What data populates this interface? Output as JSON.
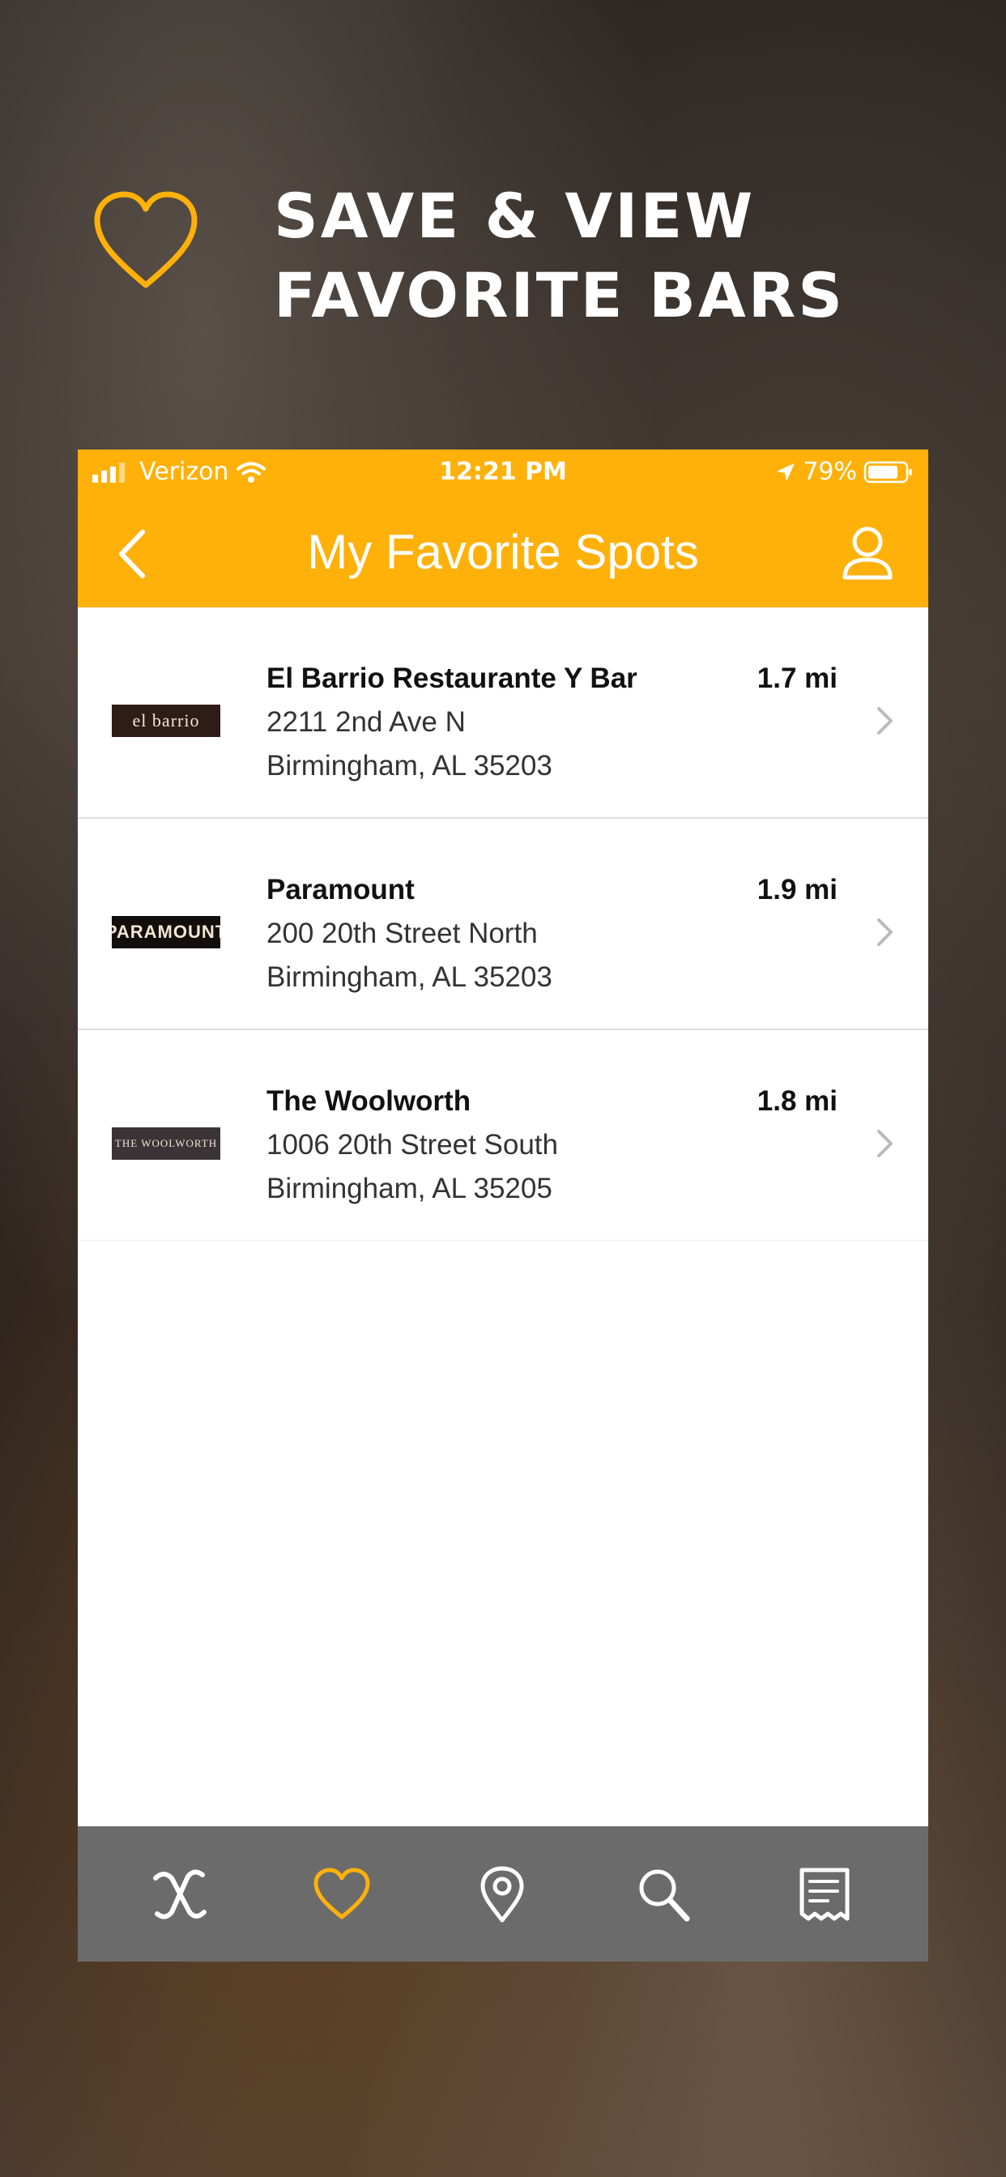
{
  "promo": {
    "title": "SAVE & VIEW\nFAVORITE BARS",
    "icon": "heart-outline-icon",
    "accent": "#FFB10A"
  },
  "status_bar": {
    "carrier": "Verizon",
    "time": "12:21 PM",
    "battery": "79%"
  },
  "nav": {
    "title": "My Favorite Spots",
    "back_icon": "chevron-left-icon",
    "profile_icon": "user-icon",
    "color": "#FFB10A"
  },
  "spots": [
    {
      "logo": "el barrio",
      "name": "El Barrio Restaurante Y Bar",
      "address": "2211 2nd Ave N",
      "city": "Birmingham, AL 35203",
      "distance": "1.7 mi"
    },
    {
      "logo": "PARAMOUNT",
      "name": "Paramount",
      "address": "200 20th Street North",
      "city": "Birmingham, AL 35203",
      "distance": "1.9 mi"
    },
    {
      "logo": "THE WOOLWORTH",
      "name": "The Woolworth",
      "address": "1006 20th Street South",
      "city": "Birmingham, AL 35205",
      "distance": "1.8 mi"
    }
  ],
  "tabs": [
    {
      "icon": "x-logo-icon",
      "active": false
    },
    {
      "icon": "heart-icon",
      "active": true
    },
    {
      "icon": "map-pin-icon",
      "active": false
    },
    {
      "icon": "search-icon",
      "active": false
    },
    {
      "icon": "receipt-icon",
      "active": false
    }
  ]
}
